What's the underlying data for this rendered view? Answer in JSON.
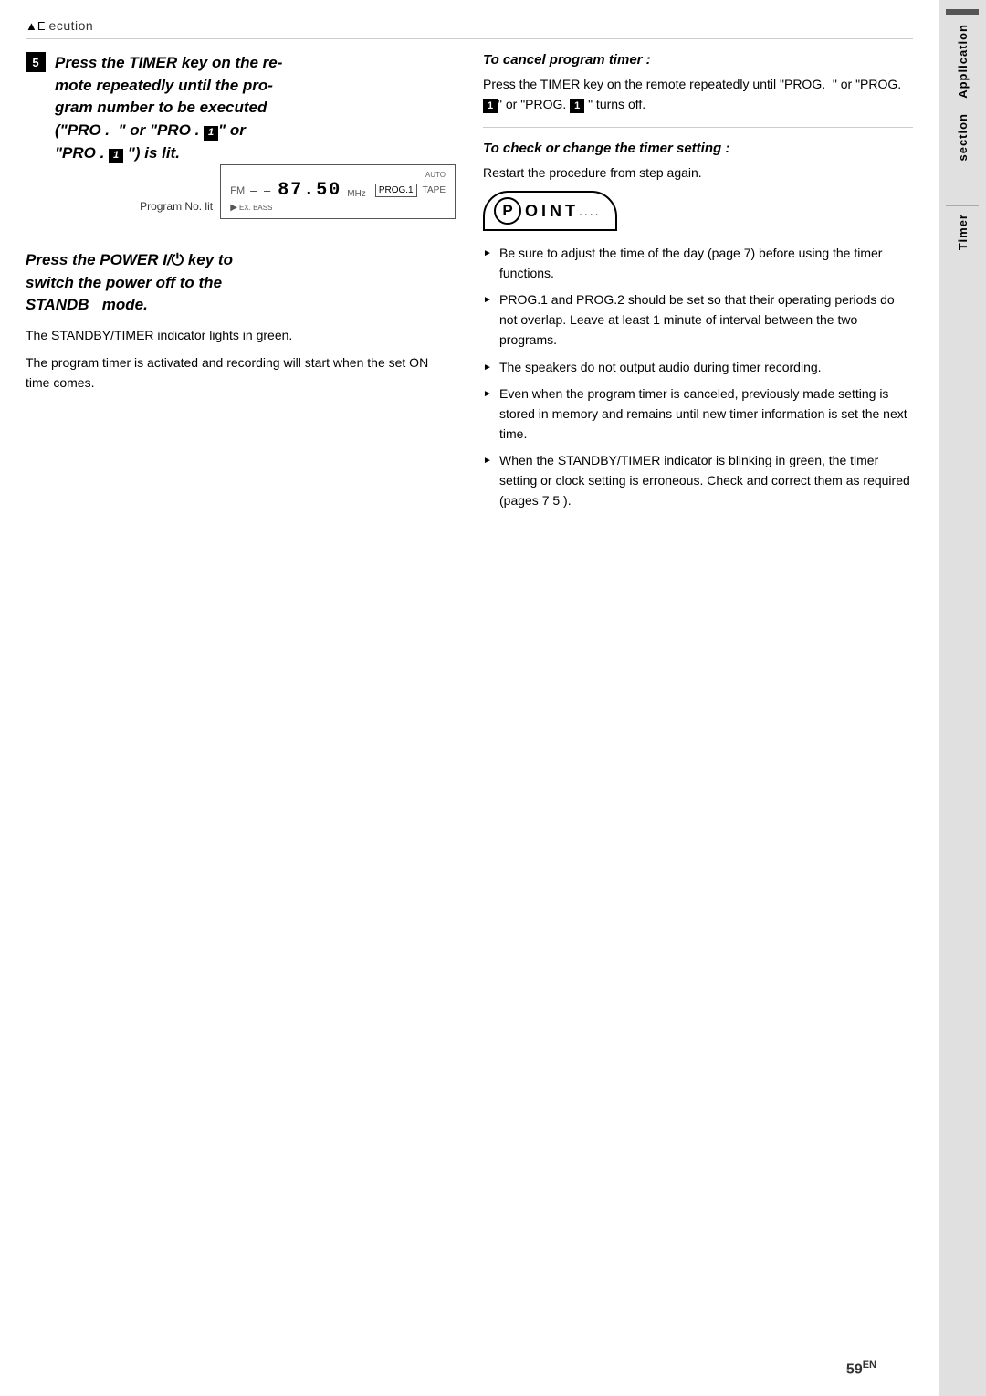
{
  "header": {
    "icon": "▲E",
    "title": "ecution"
  },
  "step5": {
    "number": "5",
    "heading_line1": "Press the TIMER key on the re-",
    "heading_line2": "mote repeatedly until the pro-",
    "heading_line3": "gram number to be executed",
    "heading_line4": "(\"PRO .  \" or \"PRO . ",
    "heading_prog_box": "1",
    "heading_line4b": "\" or",
    "heading_line5": "\"PRO . ",
    "heading_prog_box2": "1",
    "heading_line5b": " \") is lit.",
    "display_label": "Program No. lit",
    "display_fm": "FM",
    "display_freq": "87.50",
    "display_mhz": "MHz",
    "display_prog": "PROG.1",
    "display_tape": "TAPE",
    "display_auto": "AUTO"
  },
  "power_block": {
    "heading1": "Press the POWER I/",
    "heading_icon": "⏻",
    "heading2": " key to",
    "heading3": "switch the power off to the",
    "heading4": "STANDB  mode.",
    "body1": "The STANDBY/TIMER indicator lights in green.",
    "body2": "The program timer is activated and recording will start when the set ON time comes."
  },
  "cancel_section": {
    "heading": "To cancel program timer :",
    "body": "Press the TIMER key on the remote repeatedly until \"PROG.  \" or \"PROG.",
    "prog_box": "1",
    "body2": "\" or \"PROG. ",
    "prog_box2": "1",
    "body3": " \" turns off."
  },
  "check_section": {
    "heading": "To check or change the timer setting :",
    "body": "Restart the procedure from step    again."
  },
  "point_section": {
    "label": "OINT",
    "p_letter": "P",
    "bullets": [
      "Be sure to adjust the time of the day (page 7) before using the timer functions.",
      "PROG.1 and PROG.2 should be set so that their operating periods do not overlap. Leave at least 1 minute of interval between the two programs.",
      "The speakers do not output audio during timer recording.",
      "Even when the program timer is canceled, previously made setting is stored in memory and remains until new timer information is set the next time.",
      "When the STANDBY/TIMER indicator is blinking in green, the timer setting or clock setting is erroneous. Check and correct them as required (pages 7  5 )."
    ]
  },
  "sidebar": {
    "label_application": "Application",
    "label_section": "section",
    "label_timer": "Timer"
  },
  "page_number": "59",
  "page_number_sup": "EN"
}
